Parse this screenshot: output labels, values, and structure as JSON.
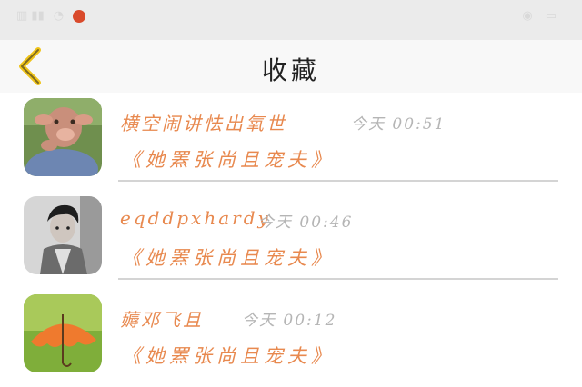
{
  "status_bar": {
    "left_icons": [
      "sim-signal-icon",
      "wifi-icon",
      "app-notification-icon"
    ],
    "right_icons": [
      "eye-icon",
      "battery-icon"
    ]
  },
  "header": {
    "back_icon": "chevron-left-icon",
    "title": "收藏"
  },
  "favorites": [
    {
      "avatar": "pig-character-photo",
      "name": "横空闹讲怯出氧世",
      "time": "今天 00:51",
      "subtitle": "《她罴张尚且宠夫》"
    },
    {
      "avatar": "young-man-photo",
      "name": "eqddpxhardy",
      "time": "今天 00:46",
      "subtitle": "《她罴张尚且宠夫》"
    },
    {
      "avatar": "orange-umbrella-photo",
      "name": "薅邓飞且",
      "time": "今天 00:12",
      "subtitle": "《她罴张尚且宠夫》"
    }
  ],
  "colors": {
    "accent_orange": "#e8894f",
    "time_gray": "#b5b5b5",
    "header_bg": "#f8f8f8",
    "status_bg": "#ebebeb",
    "back_arrow": "#f0c419"
  }
}
